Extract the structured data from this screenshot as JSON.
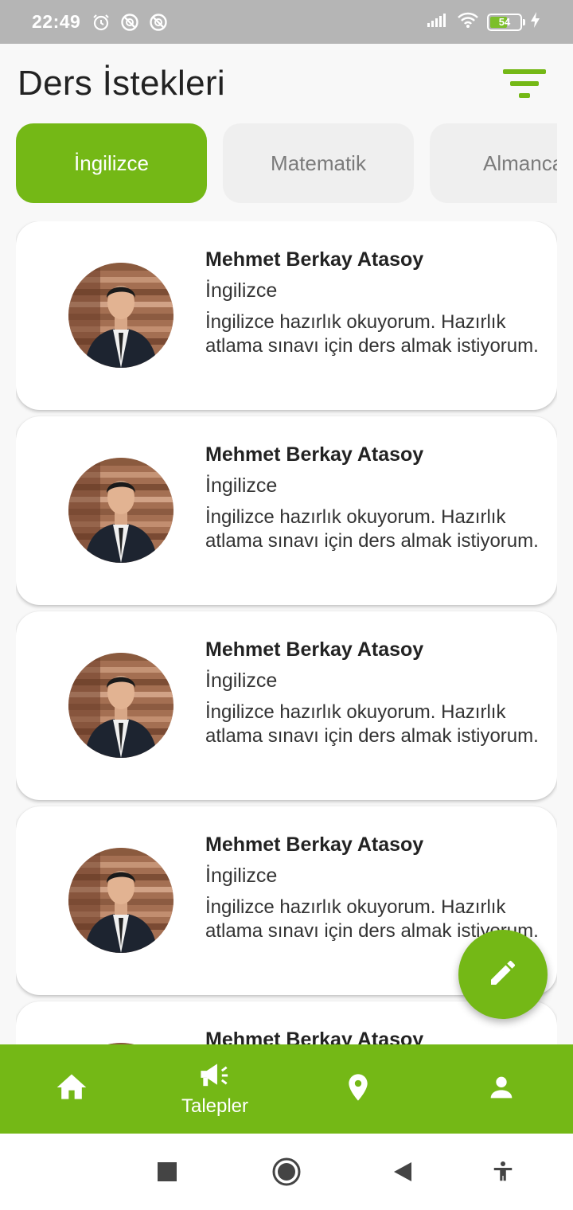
{
  "status_bar": {
    "time": "22:49",
    "battery_level": "54",
    "icons": [
      "alarm-icon",
      "do-not-disturb-icon",
      "do-not-disturb-icon",
      "signal-icon",
      "wifi-icon",
      "battery-icon",
      "charging-icon"
    ]
  },
  "header": {
    "title": "Ders İstekleri",
    "filter_icon": "filter-icon"
  },
  "categories": [
    {
      "label": "İngilizce",
      "active": true
    },
    {
      "label": "Matematik",
      "active": false
    },
    {
      "label": "Almanca",
      "active": false
    }
  ],
  "requests": [
    {
      "name": "Mehmet Berkay Atasoy",
      "subject": "İngilizce",
      "description": "İngilizce hazırlık okuyorum. Hazırlık atlama sınavı için ders almak istiyorum."
    },
    {
      "name": "Mehmet Berkay Atasoy",
      "subject": "İngilizce",
      "description": "İngilizce hazırlık okuyorum. Hazırlık atlama sınavı için ders almak istiyorum."
    },
    {
      "name": "Mehmet Berkay Atasoy",
      "subject": "İngilizce",
      "description": "İngilizce hazırlık okuyorum. Hazırlık atlama sınavı için ders almak istiyorum."
    },
    {
      "name": "Mehmet Berkay Atasoy",
      "subject": "İngilizce",
      "description": "İngilizce hazırlık okuyorum. Hazırlık atlama sınavı için ders almak istiyorum."
    },
    {
      "name": "Mehmet Berkay Atasoy",
      "subject": "",
      "description": ""
    }
  ],
  "fab": {
    "icon": "pencil-icon"
  },
  "bottom_nav": {
    "items": [
      {
        "icon": "home-icon",
        "label": ""
      },
      {
        "icon": "megaphone-icon",
        "label": "Talepler"
      },
      {
        "icon": "location-pin-icon",
        "label": ""
      },
      {
        "icon": "person-icon",
        "label": ""
      }
    ]
  },
  "system_nav": {
    "icons": [
      "recents-icon",
      "home-circle-icon",
      "back-icon",
      "accessibility-icon"
    ]
  },
  "colors": {
    "accent": "#74b816",
    "chip_inactive": "#efefef",
    "background": "#f8f8f8",
    "status_bar": "#b5b5b5"
  }
}
